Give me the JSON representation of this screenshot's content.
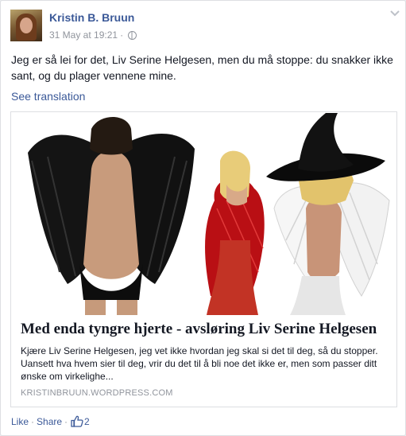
{
  "post": {
    "author": "Kristin B. Bruun",
    "timestamp": "31 May at 19:21",
    "meta_separator": "·",
    "audience_icon": "globe-icon",
    "menu_icon": "chevron-down-icon",
    "text": "Jeg er så lei for det, Liv Serine Helgesen, men du må stoppe: du snakker ikke sant, og du plager vennene mine.",
    "see_translation": "See translation"
  },
  "link_card": {
    "title": "Med enda tyngre hjerte - avsløring Liv Serine Helgesen",
    "description": "Kjære Liv Serine Helgesen, jeg vet ikke hvordan jeg skal si det til deg, så du stopper. Uansett hva hvem sier til deg, vrir du det til å bli noe det ikke er, men som passer ditt ønske om virkelighe...",
    "domain": "KRISTINBRUUN.WORDPRESS.COM"
  },
  "actions": {
    "like": "Like",
    "share": "Share",
    "separator": "·",
    "like_icon": "thumbs-up-icon",
    "like_count": "2"
  },
  "colors": {
    "link_blue": "#3b5998",
    "secondary_gray": "#90949c",
    "text": "#141823"
  }
}
